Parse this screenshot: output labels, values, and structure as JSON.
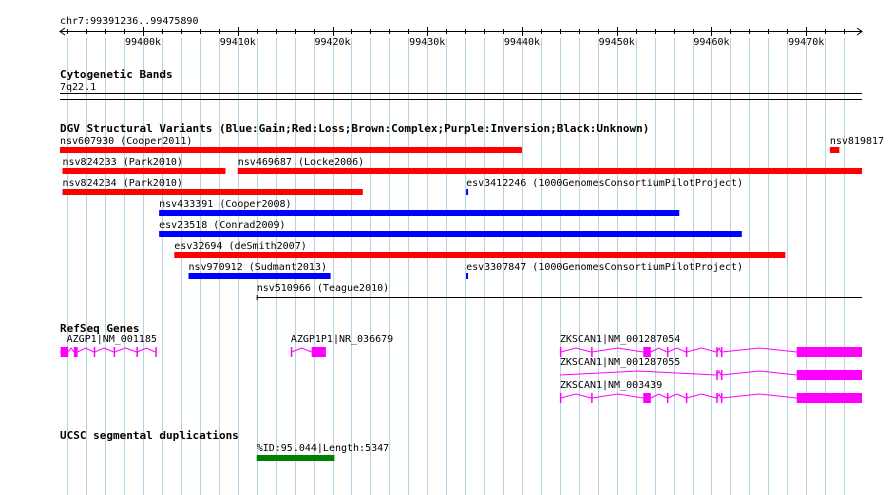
{
  "coordinates": {
    "label": "chr7:99391236..99475890",
    "start": 99391236,
    "end": 99475890
  },
  "ruler": {
    "ticks": [
      {
        "pos": 99400000,
        "label": "99400k"
      },
      {
        "pos": 99410000,
        "label": "99410k"
      },
      {
        "pos": 99420000,
        "label": "99420k"
      },
      {
        "pos": 99430000,
        "label": "99430k"
      },
      {
        "pos": 99440000,
        "label": "99440k"
      },
      {
        "pos": 99450000,
        "label": "99450k"
      },
      {
        "pos": 99460000,
        "label": "99460k"
      },
      {
        "pos": 99470000,
        "label": "99470k"
      }
    ],
    "minor_step": 2000
  },
  "tracks": {
    "cytoband": {
      "title": "Cytogenetic Bands",
      "band": "7q22.1"
    },
    "dgv": {
      "title": "DGV Structural Variants (Blue:Gain;Red:Loss;Brown:Complex;Purple:Inversion;Black:Unknown)",
      "features": [
        {
          "label": "nsv607930 (Cooper2011)",
          "start": 99391236,
          "end": 99440000,
          "type": "loss",
          "row": 0
        },
        {
          "label": "nsv819817",
          "start": 99472500,
          "end": 99473500,
          "type": "loss",
          "row": 0
        },
        {
          "label": "nsv824233 (Park2010)",
          "start": 99391500,
          "end": 99408700,
          "type": "loss",
          "row": 1
        },
        {
          "label": "nsv469687 (Locke2006)",
          "start": 99410000,
          "end": 99475890,
          "type": "loss",
          "row": 1
        },
        {
          "label": "nsv824234 (Park2010)",
          "start": 99391500,
          "end": 99423200,
          "type": "loss",
          "row": 2
        },
        {
          "label": "esv3412246 (1000GenomesConsortiumPilotProject)",
          "start": 99434100,
          "end": 99434300,
          "type": "gain",
          "row": 2
        },
        {
          "label": "nsv433391 (Cooper2008)",
          "start": 99401700,
          "end": 99456600,
          "type": "gain",
          "row": 3
        },
        {
          "label": "esv23518 (Conrad2009)",
          "start": 99401700,
          "end": 99463200,
          "type": "gain",
          "row": 4
        },
        {
          "label": "esv32694 (deSmith2007)",
          "start": 99403300,
          "end": 99467800,
          "type": "loss",
          "row": 5
        },
        {
          "label": "nsv970912 (Sudmant2013)",
          "start": 99404800,
          "end": 99419800,
          "type": "gain",
          "row": 6
        },
        {
          "label": "esv3307847 (1000GenomesConsortiumPilotProject)",
          "start": 99434100,
          "end": 99434300,
          "type": "gain",
          "row": 6
        },
        {
          "label": "nsv510966 (Teague2010)",
          "start": 99412000,
          "end": 99475890,
          "type": "unknown",
          "row": 7
        }
      ]
    },
    "refseq": {
      "title": "RefSeq Genes",
      "features": [
        {
          "label": "AZGP1|NM_001185",
          "start": 99391300,
          "end": 99401400,
          "strand": "-",
          "row": 0,
          "exons": [
            [
              99391300,
              99392100
            ],
            [
              99392700,
              99393100
            ],
            [
              99394800,
              99394900
            ],
            [
              99396900,
              99397000
            ],
            [
              99399300,
              99399400
            ],
            [
              99401300,
              99401400
            ]
          ]
        },
        {
          "label": "AZGP1P1|NR_036679",
          "start": 99415600,
          "end": 99419300,
          "strand": "+",
          "row": 0,
          "exons": [
            [
              99415600,
              99415700
            ],
            [
              99417800,
              99419300
            ]
          ]
        },
        {
          "label": "ZKSCAN1|NM_001287054",
          "start": 99444000,
          "end": 99475890,
          "strand": "+",
          "row": 0,
          "exons": [
            [
              99444000,
              99444100
            ],
            [
              99447300,
              99447400
            ],
            [
              99452800,
              99453600
            ],
            [
              99455300,
              99455400
            ],
            [
              99457300,
              99457400
            ],
            [
              99460500,
              99460600
            ],
            [
              99461000,
              99461100
            ],
            [
              99469000,
              99475890
            ]
          ]
        },
        {
          "label": "ZKSCAN1|NM_001287055",
          "start": 99444000,
          "end": 99475890,
          "strand": "+",
          "row": 1,
          "exons": [
            [
              99460500,
              99460600
            ],
            [
              99461000,
              99461100
            ],
            [
              99469000,
              99475890
            ]
          ]
        },
        {
          "label": "ZKSCAN1|NM_003439",
          "start": 99444000,
          "end": 99475890,
          "strand": "+",
          "row": 2,
          "exons": [
            [
              99444000,
              99444100
            ],
            [
              99447300,
              99447400
            ],
            [
              99452800,
              99453600
            ],
            [
              99455300,
              99455400
            ],
            [
              99457300,
              99457400
            ],
            [
              99460500,
              99460600
            ],
            [
              99461000,
              99461100
            ],
            [
              99469000,
              99475890
            ]
          ]
        }
      ]
    },
    "segdup": {
      "title": "UCSC segmental duplications",
      "features": [
        {
          "label": "%ID:95.044|Length:5347",
          "start": 99412000,
          "end": 99420200
        }
      ]
    }
  },
  "colors": {
    "loss": "#ff0000",
    "gain": "#0000ff",
    "unknown": "#000000",
    "gene": "#ff00ff",
    "segdup": "#008000",
    "grid": "#b4d4e4"
  }
}
